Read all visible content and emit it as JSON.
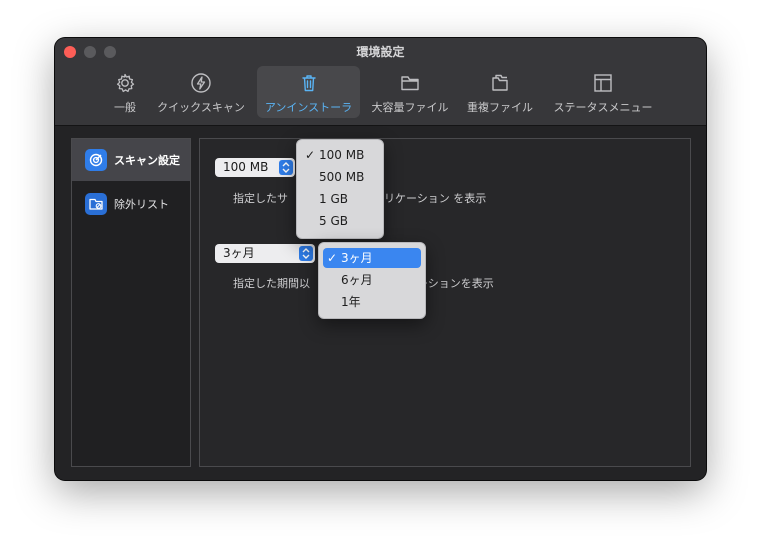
{
  "window": {
    "title": "環境設定",
    "accent_color": "#5ab4f5",
    "close_color": "#fd5e57"
  },
  "tabs": [
    {
      "label": "一般",
      "icon": "gear-icon"
    },
    {
      "label": "クイックスキャン",
      "icon": "lightning-icon"
    },
    {
      "label": "アンインストーラ",
      "icon": "trash-icon",
      "active": true
    },
    {
      "label": "大容量ファイル",
      "icon": "folder-icon"
    },
    {
      "label": "重複ファイル",
      "icon": "duplicate-folder-icon"
    },
    {
      "label": "ステータスメニュー",
      "icon": "layout-icon"
    }
  ],
  "sidebar": {
    "items": [
      {
        "label": "スキャン設定",
        "icon": "target-icon",
        "active": true
      },
      {
        "label": "除外リスト",
        "icon": "exclude-folder-icon"
      }
    ]
  },
  "settings": {
    "size_select": {
      "value": "100 MB"
    },
    "size_description": "指定したサ",
    "size_description_end": "リケーション を表示",
    "period_select": {
      "value": "3ヶ月"
    },
    "period_description": "指定した期間以",
    "period_description_end": "ーションを表示"
  },
  "size_menu": {
    "options": [
      "100 MB",
      "500 MB",
      "1 GB",
      "5 GB"
    ],
    "selected": "100 MB",
    "check_mark": "✓"
  },
  "period_menu": {
    "options": [
      "3ヶ月",
      "6ヶ月",
      "1年"
    ],
    "selected": "3ヶ月",
    "check_mark": "✓"
  }
}
